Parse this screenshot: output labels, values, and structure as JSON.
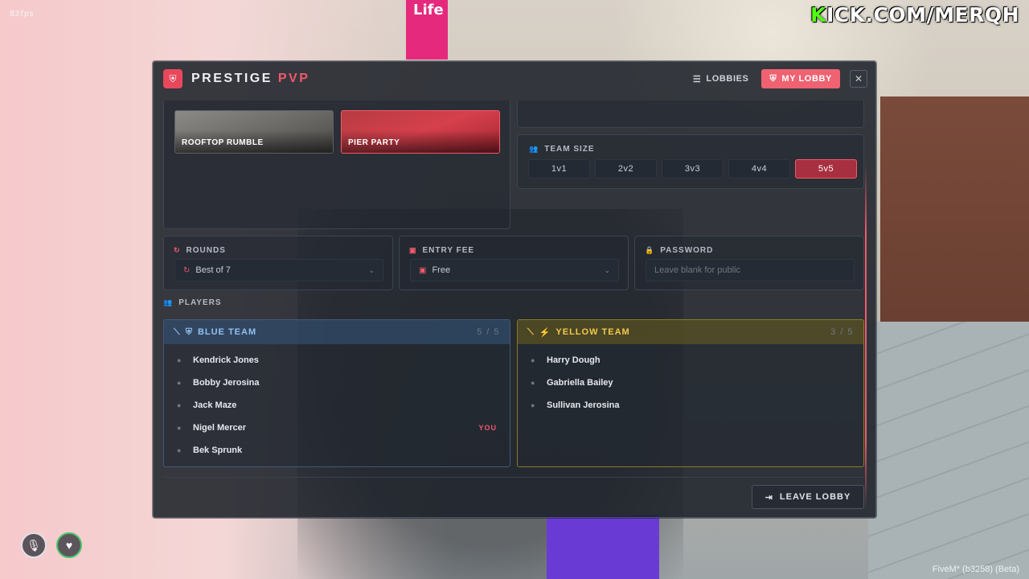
{
  "overlay": {
    "fps": "83fps",
    "brand_k": "K",
    "brand_rest": "ICK.COM/MERQH",
    "fivem_version": "FiveM* (b3258) (Beta)",
    "sign_text": "Life"
  },
  "header": {
    "title_main": "PRESTIGE",
    "title_accent": "PVP",
    "tabs": [
      {
        "label": "LOBBIES",
        "icon": "list-icon",
        "active": false
      },
      {
        "label": "MY LOBBY",
        "icon": "shield-icon",
        "active": true
      }
    ],
    "close_label": "✕"
  },
  "maps": [
    {
      "name": "ROOFTOP RUMBLE",
      "selected": false
    },
    {
      "name": "PIER PARTY",
      "selected": true
    }
  ],
  "team_size": {
    "label": "TEAM SIZE",
    "options": [
      "1v1",
      "2v2",
      "3v3",
      "4v4",
      "5v5"
    ],
    "selected": "5v5"
  },
  "rounds": {
    "label": "ROUNDS",
    "value": "Best of 7"
  },
  "entry_fee": {
    "label": "ENTRY FEE",
    "value": "Free"
  },
  "password": {
    "label": "PASSWORD",
    "placeholder": "Leave blank for public"
  },
  "players": {
    "label": "PLAYERS",
    "blue_team": {
      "name": "BLUE TEAM",
      "count": "5 / 5",
      "players": [
        "Kendrick Jones",
        "Bobby Jerosina",
        "Jack Maze",
        "Nigel Mercer",
        "Bek Sprunk"
      ],
      "you_label": "YOU",
      "you_index": 3
    },
    "yellow_team": {
      "name": "YELLOW TEAM",
      "count": "3 / 5",
      "players": [
        "Harry Dough",
        "Gabriella Bailey",
        "Sullivan Jerosina"
      ]
    }
  },
  "leave_label": "LEAVE LOBBY",
  "colors": {
    "accent": "#ef5a6b",
    "blue_team": "#8fc0f0",
    "yellow_team": "#f2c94c",
    "panel_bg": "#1c2129"
  }
}
